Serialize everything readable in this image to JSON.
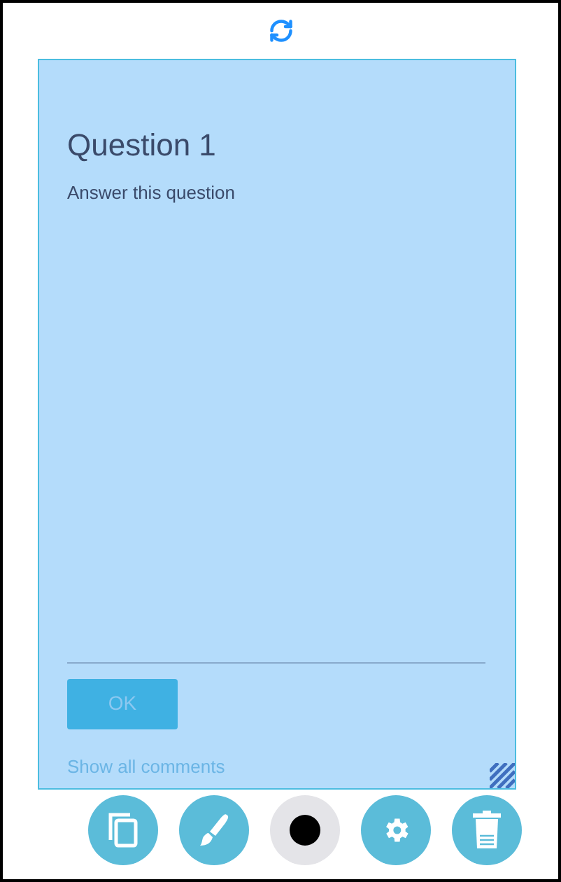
{
  "question": {
    "title": "Question 1",
    "prompt": "Answer this question",
    "submit": "OK",
    "comments_link": "Show all comments"
  },
  "toolbar": [
    {
      "kind": "copy"
    },
    {
      "kind": "brush"
    },
    {
      "kind": "color",
      "color": "#000000"
    },
    {
      "kind": "settings"
    },
    {
      "kind": "trash"
    }
  ]
}
